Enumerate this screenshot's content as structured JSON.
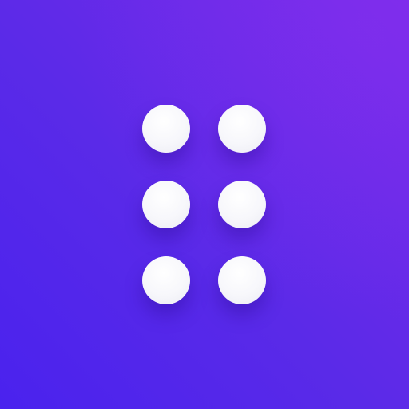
{
  "icon": {
    "name": "six-dot-grid-icon",
    "rows": 3,
    "columns": 2,
    "dot_color": "#f6f6fa",
    "background_colors": [
      "#4a22ee",
      "#7a2bea"
    ]
  },
  "dots": [
    {
      "id": "dot-1"
    },
    {
      "id": "dot-2"
    },
    {
      "id": "dot-3"
    },
    {
      "id": "dot-4"
    },
    {
      "id": "dot-5"
    },
    {
      "id": "dot-6"
    }
  ]
}
